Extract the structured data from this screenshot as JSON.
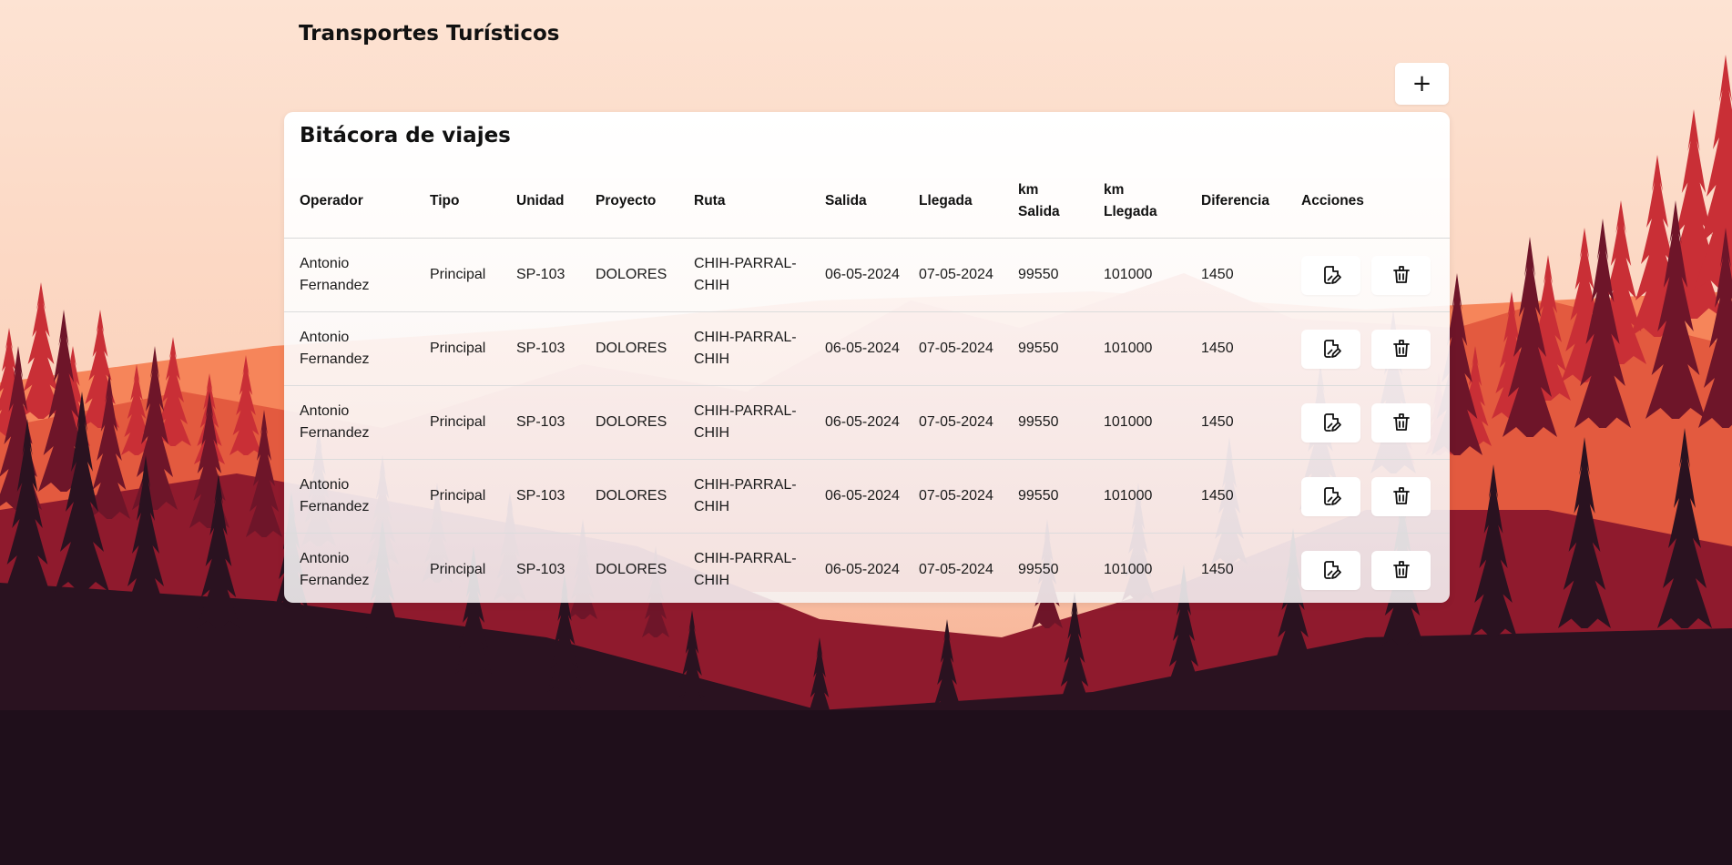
{
  "app": {
    "title": "Transportes Turísticos",
    "add_label": "+"
  },
  "card": {
    "title": "Bitácora de viajes"
  },
  "table": {
    "headers": {
      "operador": "Operador",
      "tipo": "Tipo",
      "unidad": "Unidad",
      "proyecto": "Proyecto",
      "ruta": "Ruta",
      "salida": "Salida",
      "llegada": "Llegada",
      "km_salida_1": "km",
      "km_salida_2": "Salida",
      "km_llegada_1": "km",
      "km_llegada_2": "Llegada",
      "diferencia": "Diferencia",
      "acciones": "Acciones"
    },
    "rows": [
      {
        "operador": "Antonio Fernandez",
        "tipo": "Principal",
        "unidad": "SP-103",
        "proyecto": "DOLORES",
        "ruta": "CHIH-PARRAL-CHIH",
        "salida": "06-05-2024",
        "llegada": "07-05-2024",
        "km_salida": "99550",
        "km_llegada": "101000",
        "diferencia": "1450"
      },
      {
        "operador": "Antonio Fernandez",
        "tipo": "Principal",
        "unidad": "SP-103",
        "proyecto": "DOLORES",
        "ruta": "CHIH-PARRAL-CHIH",
        "salida": "06-05-2024",
        "llegada": "07-05-2024",
        "km_salida": "99550",
        "km_llegada": "101000",
        "diferencia": "1450"
      },
      {
        "operador": "Antonio Fernandez",
        "tipo": "Principal",
        "unidad": "SP-103",
        "proyecto": "DOLORES",
        "ruta": "CHIH-PARRAL-CHIH",
        "salida": "06-05-2024",
        "llegada": "07-05-2024",
        "km_salida": "99550",
        "km_llegada": "101000",
        "diferencia": "1450"
      },
      {
        "operador": "Antonio Fernandez",
        "tipo": "Principal",
        "unidad": "SP-103",
        "proyecto": "DOLORES",
        "ruta": "CHIH-PARRAL-CHIH",
        "salida": "06-05-2024",
        "llegada": "07-05-2024",
        "km_salida": "99550",
        "km_llegada": "101000",
        "diferencia": "1450"
      },
      {
        "operador": "Antonio Fernandez",
        "tipo": "Principal",
        "unidad": "SP-103",
        "proyecto": "DOLORES",
        "ruta": "CHIH-PARRAL-CHIH",
        "salida": "06-05-2024",
        "llegada": "07-05-2024",
        "km_salida": "99550",
        "km_llegada": "101000",
        "diferencia": "1450"
      }
    ],
    "row_actions": {
      "edit_icon": "edit-document-icon",
      "delete_icon": "trash-icon"
    }
  },
  "colors": {
    "sky_top": "#fde3d3",
    "sky_bottom": "#fac7ad",
    "sun_glow": "#f6855a",
    "mountain_far": "#e8604a",
    "forest_red": "#c92f36",
    "forest_dark": "#6e1529",
    "ground_dark": "#1f0f1b",
    "card_bg": "#ffffff"
  }
}
